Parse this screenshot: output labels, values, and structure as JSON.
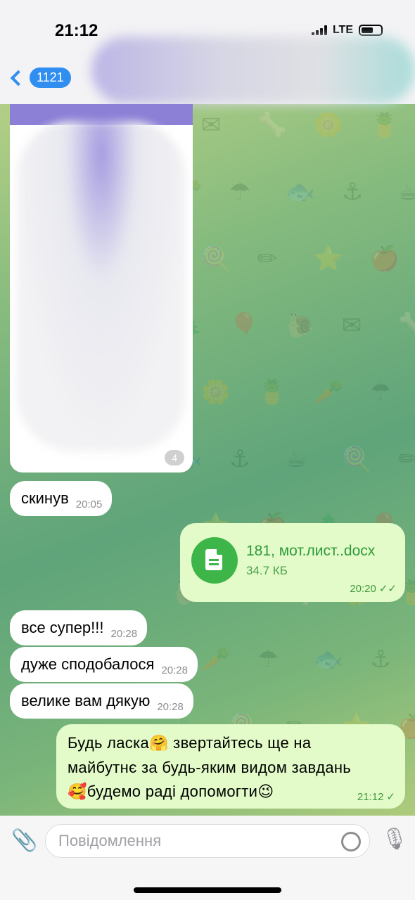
{
  "status_bar": {
    "time": "21:12",
    "network": "LTE"
  },
  "header": {
    "back_badge": "1121"
  },
  "wallpaper_icons": [
    "✉",
    "🦴",
    "🌼",
    "🍍",
    "🥕",
    "☂",
    "🐟",
    "⚓",
    "☕",
    "🍭",
    "✏",
    "⭐",
    "🍎",
    "🌲",
    "🎈",
    "🐌"
  ],
  "messages": {
    "photo": {
      "time": "4"
    },
    "incoming_1": {
      "text": "скинув",
      "time": "20:05"
    },
    "file": {
      "name": "181, мот.лист..docx",
      "size": "34.7 КБ",
      "time": "20:20",
      "status": "✓✓"
    },
    "incoming_2": {
      "text": "все супер!!!",
      "time": "20:28"
    },
    "incoming_3": {
      "text": "дуже сподобалося",
      "time": "20:28"
    },
    "incoming_4": {
      "text": "велике вам дякую",
      "time": "20:28"
    },
    "reply": {
      "line1a": "Будь ласка",
      "emoji1": "🤗",
      "line1b": " звертайтесь ще на",
      "line2": "майбутнє за будь-яким видом завдань",
      "emoji2": "🥰",
      "line3": "будемо раді допомогти",
      "emoji3": "😉",
      "time": "21:12",
      "status": "✓"
    }
  },
  "composer": {
    "placeholder": "Повідомлення"
  },
  "colors": {
    "accent": "#2f8ef0",
    "outgoing_bubble": "#e2fbc8",
    "file_icon": "#3eb548"
  }
}
